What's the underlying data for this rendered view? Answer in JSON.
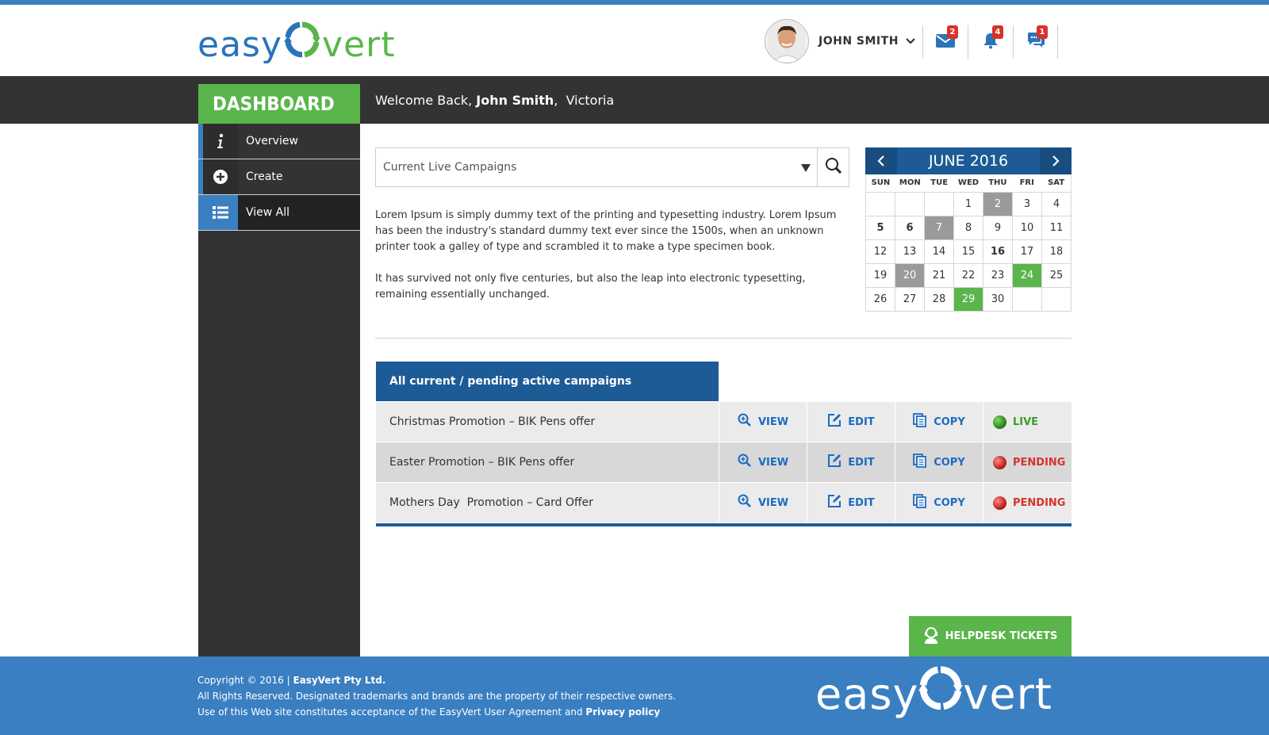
{
  "brand": {
    "logo_left": "easy",
    "logo_right": "vert",
    "logo_icon": "recycle-arrows-icon",
    "accent": "#3a7fc1",
    "green": "#5ab54b",
    "navy": "#1d5b96"
  },
  "header": {
    "username": "JOHN SMITH",
    "notifications": [
      {
        "icon": "mail-icon",
        "count": "2"
      },
      {
        "icon": "bell-icon",
        "count": "4"
      },
      {
        "icon": "chat-icon",
        "count": "1"
      }
    ]
  },
  "dashboard": {
    "title": "DASHBOARD",
    "welcome_prefix": "Welcome Back,",
    "welcome_name": "John Smith",
    "welcome_suffix": ",  Victoria"
  },
  "sidebar": {
    "items": [
      {
        "label": "Overview",
        "icon": "info-icon"
      },
      {
        "label": "Create",
        "icon": "plus-circle-icon"
      },
      {
        "label": "View All",
        "icon": "list-icon"
      }
    ]
  },
  "search": {
    "selected": "Current Live Campaigns"
  },
  "intro": {
    "p1": "Lorem Ipsum is simply dummy text of the printing and typesetting industry. Lorem Ipsum has been the industry's standard dummy text ever since the 1500s, when an unknown printer took a galley of type and scrambled it to make a type specimen book.",
    "p2": "It has survived not only five centuries, but also the leap into electronic typesetting, remaining essentially unchanged."
  },
  "calendar": {
    "title": "JUNE 2016",
    "dow": [
      "SUN",
      "MON",
      "TUE",
      "WED",
      "THU",
      "FRI",
      "SAT"
    ],
    "cells": [
      {
        "d": "",
        "s": ""
      },
      {
        "d": "",
        "s": ""
      },
      {
        "d": "",
        "s": ""
      },
      {
        "d": "1",
        "s": ""
      },
      {
        "d": "2",
        "s": "grey"
      },
      {
        "d": "3",
        "s": ""
      },
      {
        "d": "4",
        "s": ""
      },
      {
        "d": "5",
        "s": "bold"
      },
      {
        "d": "6",
        "s": "bold"
      },
      {
        "d": "7",
        "s": "grey"
      },
      {
        "d": "8",
        "s": ""
      },
      {
        "d": "9",
        "s": ""
      },
      {
        "d": "10",
        "s": ""
      },
      {
        "d": "11",
        "s": ""
      },
      {
        "d": "12",
        "s": ""
      },
      {
        "d": "13",
        "s": ""
      },
      {
        "d": "14",
        "s": ""
      },
      {
        "d": "15",
        "s": ""
      },
      {
        "d": "16",
        "s": "bold"
      },
      {
        "d": "17",
        "s": ""
      },
      {
        "d": "18",
        "s": ""
      },
      {
        "d": "19",
        "s": ""
      },
      {
        "d": "20",
        "s": "grey"
      },
      {
        "d": "21",
        "s": ""
      },
      {
        "d": "22",
        "s": ""
      },
      {
        "d": "23",
        "s": ""
      },
      {
        "d": "24",
        "s": "green"
      },
      {
        "d": "25",
        "s": ""
      },
      {
        "d": "26",
        "s": ""
      },
      {
        "d": "27",
        "s": ""
      },
      {
        "d": "28",
        "s": ""
      },
      {
        "d": "29",
        "s": "green"
      },
      {
        "d": "30",
        "s": ""
      },
      {
        "d": "",
        "s": ""
      },
      {
        "d": "",
        "s": ""
      }
    ]
  },
  "campaigns": {
    "heading": "All current / pending active campaigns",
    "actions": {
      "view": "VIEW",
      "edit": "EDIT",
      "copy": "COPY"
    },
    "rows": [
      {
        "name": "Christmas Promotion – BIK Pens offer",
        "status": "LIVE"
      },
      {
        "name": "Easter Promotion – BIK Pens offer",
        "status": "PENDING"
      },
      {
        "name": "Mothers Day  Promotion – Card Offer",
        "status": "PENDING"
      }
    ]
  },
  "helpdesk": {
    "label": "HELPDESK TICKETS"
  },
  "footer": {
    "line1_prefix": "Copyright © 2016 |",
    "line1_company": "EasyVert Pty Ltd.",
    "line2": "All Rights Reserved. Designated trademarks and brands are the property of their respective owners.",
    "line3_prefix": "Use of this Web site constitutes acceptance of the EasyVert User Agreement and",
    "line3_link": "Privacy policy",
    "logo_left": "easy",
    "logo_right": "vert"
  }
}
